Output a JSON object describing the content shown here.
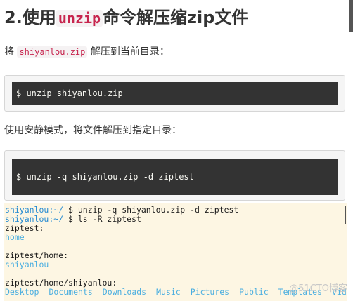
{
  "heading": {
    "prefix": "2.使用",
    "command": "unzip",
    "suffix": "命令解压缩zip文件"
  },
  "para1": {
    "before": "将",
    "filename": "shiyanlou.zip",
    "after": "解压到当前目录："
  },
  "code1": "$ unzip shiyanlou.zip",
  "para2": "使用安静模式，将文件解压到指定目录：",
  "code2": "$ unzip -q shiyanlou.zip -d ziptest",
  "terminal": {
    "user": "shiyanlou",
    "path": ":~/",
    "cmd1": "$ unzip -q shiyanlou.zip -d ziptest",
    "cmd2": "$ ls -R ziptest",
    "out1": "ziptest:",
    "out2": "home",
    "out3": "ziptest/home:",
    "out4": "shiyanlou",
    "out5": "ziptest/home/shiyanlou:",
    "dirs": [
      "Desktop",
      "Documents",
      "Downloads",
      "Music",
      "Pictures",
      "Public",
      "Templates",
      "Vid"
    ]
  },
  "watermark": "@51CTO博客"
}
